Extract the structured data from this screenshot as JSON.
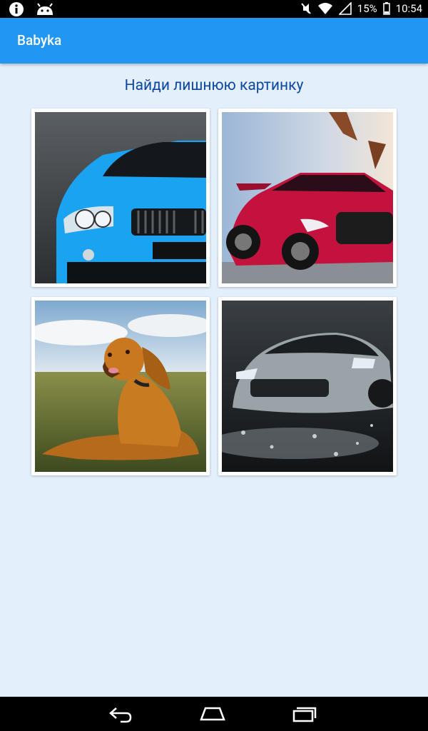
{
  "status_bar": {
    "battery": "15%",
    "time": "10:54",
    "left_icons": [
      "info-icon",
      "android-icon"
    ],
    "right_icons": [
      "mute-icon",
      "wifi-icon",
      "signal-icon",
      "battery-icon"
    ]
  },
  "app_bar": {
    "title": "Babyka"
  },
  "game": {
    "prompt": "Найди лишнюю картинку",
    "tiles": [
      {
        "subject": "blue-car"
      },
      {
        "subject": "red-car"
      },
      {
        "subject": "dog"
      },
      {
        "subject": "silver-car"
      }
    ]
  },
  "nav_bar": {
    "buttons": [
      "back-icon",
      "home-icon",
      "recents-icon"
    ]
  },
  "colors": {
    "app_bar": "#2196f3",
    "background": "#e3f0fc",
    "prompt": "#0d47a1"
  }
}
